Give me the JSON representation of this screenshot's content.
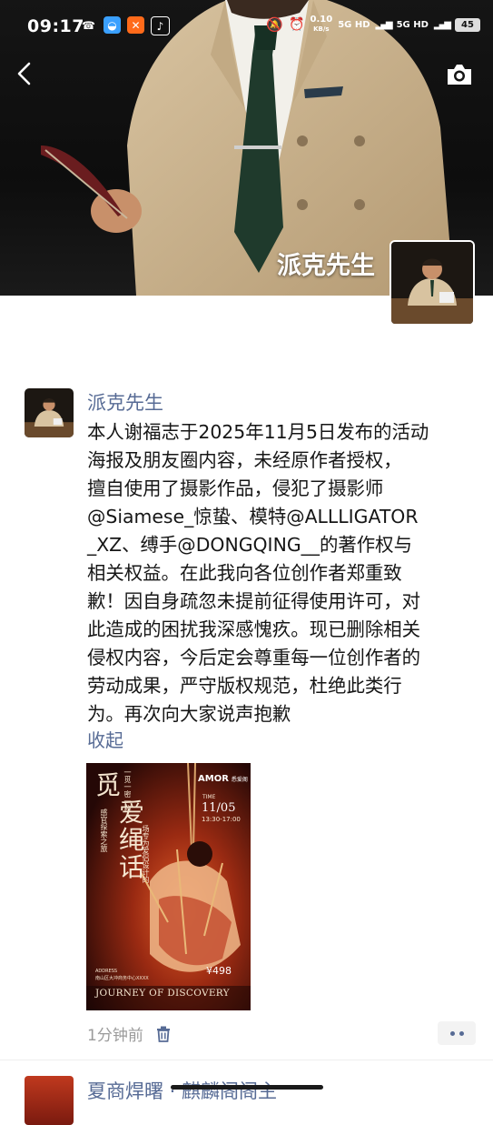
{
  "status_bar": {
    "time": "09:17",
    "net_speed": "0.10",
    "net_unit": "KB/s",
    "signal1": "5G HD",
    "signal2": "5G HD",
    "battery": "45"
  },
  "cover": {
    "name": "派克先生"
  },
  "post": {
    "author": "派克先生",
    "text_lines": [
      "本人谢福志于2025年11月5日发布的活动",
      "海报及朋友圈内容，未经原作者授权，",
      "擅自使用了摄影作品，侵犯了摄影师",
      "@Siamese_惊蛰、模特@ALLLIGATOR",
      "_XZ、缚手@DONGQING__的著作权与",
      "相关权益。在此我向各位创作者郑重致",
      "歉！因自身疏忽未提前征得使用许可，对",
      "此造成的困扰我深感愧疚。现已删除相关",
      "侵权内容，今后定会尊重每一位创作者的",
      "劳动成果，严守版权规范，杜绝此类行",
      "为。再次向大家说声抱歉"
    ],
    "collapse_label": "收起",
    "time_ago": "1分钟前",
    "poster": {
      "title_a": "觅",
      "title_b": "爱",
      "title_c": "绳",
      "title_d": "话",
      "small_vertical_1": "一觅一密一秘",
      "small_vertical_2": "感官探索之旅",
      "small_vertical_3": "场专为爱侣设计的",
      "brand": "AMOR",
      "brand_sub": "悉爱阁",
      "time_label": "TIME",
      "date": "11/05",
      "hours": "13:30-17:00",
      "price": "¥498",
      "address_label": "ADDRESS",
      "address": "南山区大冲商务中心XXXX",
      "footer": "JOURNEY OF DISCOVERY"
    }
  },
  "next_post": {
    "author": "夏商焊曙 · 麒麟阁阁主"
  }
}
